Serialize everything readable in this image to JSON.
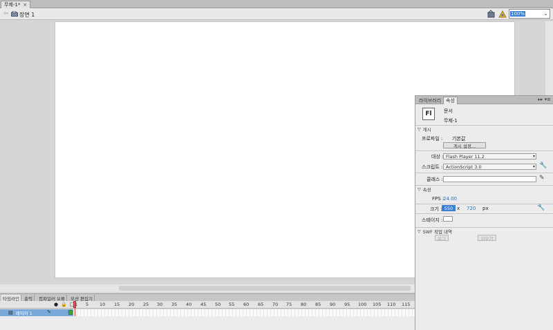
{
  "document_tab": {
    "title": "무제-1*",
    "close": "×"
  },
  "edit_bar": {
    "back_arrow": "⇦",
    "scene": "장면 1",
    "zoom": "100%"
  },
  "properties_panel": {
    "tabs": [
      "라이브러리",
      "속성"
    ],
    "menu": "▸▸ ▾≡",
    "doc_icon": "Fl",
    "doc_type": "문서",
    "doc_name": "무제-1",
    "publish": {
      "section": "게시",
      "profile_label": "프로파일 :",
      "profile_value": "기본값",
      "settings_button": "게시 설정...",
      "target_label": "대상 :",
      "target_value": "Flash Player 11.2",
      "script_label": "스크립트 :",
      "script_value": "ActionScript 3.0",
      "class_label": "클래스 :"
    },
    "properties": {
      "section": "속성",
      "fps_label": "FPS :",
      "fps_value": "24.00",
      "size_label": "크기 :",
      "width": "550",
      "times": "x",
      "height": "720",
      "unit": "px",
      "stage_label": "스테이지 :"
    },
    "swf_history": {
      "section": "SWF 작업 내역",
      "log_button": "로그",
      "clear_button": "지우기"
    }
  },
  "timeline": {
    "tabs": [
      "타임라인",
      "출력",
      "컴파일러 오류",
      "모션 편집기"
    ],
    "header_icons": [
      "●",
      "🔒",
      "□"
    ],
    "ruler": [
      "1",
      "5",
      "10",
      "15",
      "20",
      "25",
      "30",
      "35",
      "40",
      "45",
      "50",
      "55",
      "60",
      "65",
      "70",
      "75",
      "80",
      "85",
      "90",
      "95",
      "100",
      "105",
      "110",
      "115"
    ],
    "layer_name": "레이어 1"
  },
  "colors": {
    "selection": "#3b7fd0",
    "layer_row": "#7aa8d8",
    "playhead": "#d43c3c"
  }
}
